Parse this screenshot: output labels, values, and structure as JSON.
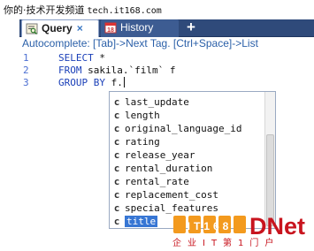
{
  "watermark": {
    "text": "你的·技术开发频道",
    "site": "tech.it168.com"
  },
  "tabs": [
    {
      "label": "Query",
      "close": "×",
      "active": true,
      "icon": "query-tab-icon"
    },
    {
      "label": "History",
      "active": false,
      "icon": "history-calendar-icon",
      "icon_text": "18"
    }
  ],
  "new_tab_glyph": "+",
  "hint": "Autocomplete: [Tab]->Next Tag. [Ctrl+Space]->List",
  "editor": {
    "lines": [
      {
        "no": "1",
        "keyword": "SELECT",
        "rest": " *"
      },
      {
        "no": "2",
        "keyword": "FROM",
        "rest": " sakila.`film` f"
      },
      {
        "no": "3",
        "keyword": "GROUP BY",
        "rest": " f."
      }
    ]
  },
  "autocomplete": {
    "item_icon": "c",
    "items": [
      "last_update",
      "length",
      "original_language_id",
      "rating",
      "release_year",
      "rental_duration",
      "rental_rate",
      "replacement_cost",
      "special_features",
      "title"
    ],
    "selected_index": 9
  },
  "logo": {
    "brand_left": "IT168",
    "brand_right": "DNet",
    "tagline": "企业IT第1门户"
  },
  "colors": {
    "tabbar": "#2f4a7a",
    "keyword": "#1a3fb8",
    "line_number": "#4c6fd2",
    "selection": "#3776d4",
    "hint": "#2a5fa8",
    "logo_red": "#c8141e",
    "logo_orange": "#f39a1e"
  }
}
